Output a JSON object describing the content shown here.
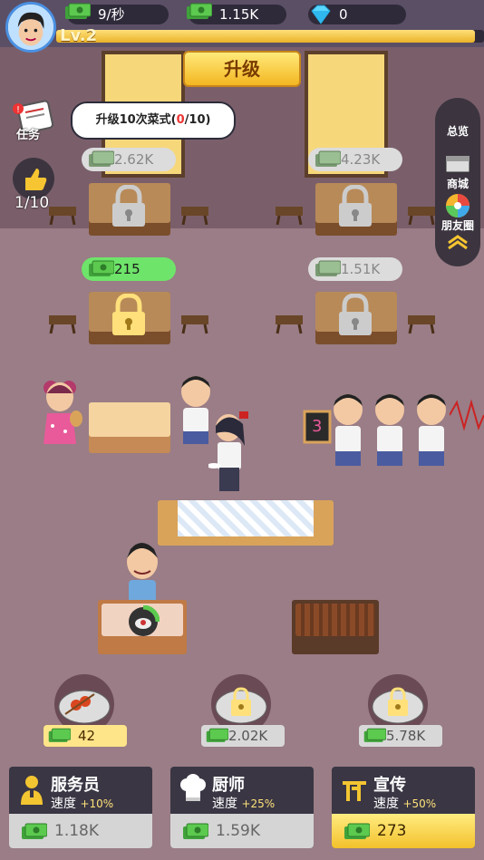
{
  "header": {
    "income_rate": "9/秒",
    "cash": "1.15K",
    "gems": "0",
    "level": "Lv.2",
    "upgrade_button": "升级"
  },
  "task": {
    "icon_label": "任务",
    "text_prefix": "升级10次菜式(",
    "progress_current": "0",
    "text_suffix": "/10)"
  },
  "likes": {
    "count": "1/10"
  },
  "side_menu": {
    "overview": "总览",
    "shop": "商城",
    "moments": "朋友圈"
  },
  "tables": [
    {
      "price": "2.62K",
      "active": false
    },
    {
      "price": "4.23K",
      "active": false
    },
    {
      "price": "215",
      "active": true
    },
    {
      "price": "1.51K",
      "active": false
    }
  ],
  "queue": {
    "count": "3"
  },
  "dishes": [
    {
      "cost": "42",
      "active": true
    },
    {
      "cost": "2.02K",
      "active": false
    },
    {
      "cost": "5.78K",
      "active": false
    }
  ],
  "panels": [
    {
      "title": "服务员",
      "speed_label": "速度",
      "speed_pct": "+10%",
      "cost": "1.18K",
      "active": false
    },
    {
      "title": "厨师",
      "speed_label": "速度",
      "speed_pct": "+25%",
      "cost": "1.59K",
      "active": false
    },
    {
      "title": "宣传",
      "speed_label": "速度",
      "speed_pct": "+50%",
      "cost": "273",
      "active": true
    }
  ],
  "colors": {
    "accent": "#f3c12c",
    "active_price": "#6ee46a",
    "panel_bg": "#3a3644"
  }
}
